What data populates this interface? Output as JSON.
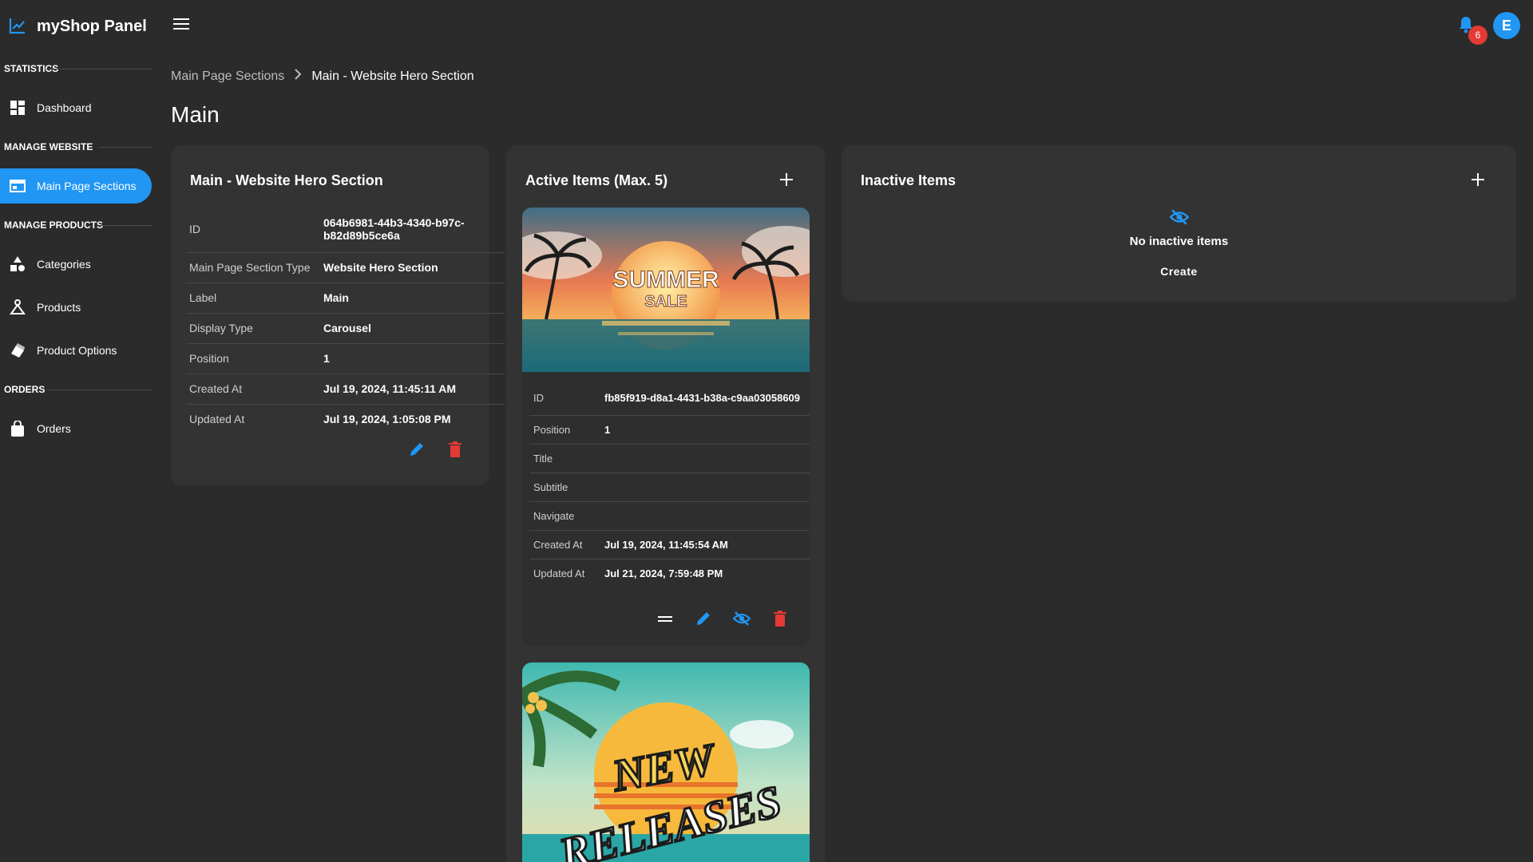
{
  "app": {
    "brand": "myShop Panel",
    "brand_icon": "trending-up-icon",
    "notifications_count": "6",
    "avatar_initial": "E",
    "accent_color": "#2196f3",
    "danger_color": "#e53935"
  },
  "sidebar": {
    "sections": [
      {
        "heading": "STATISTICS",
        "items": [
          {
            "label": "Dashboard",
            "icon": "dashboard-icon"
          }
        ]
      },
      {
        "heading": "MANAGE WEBSITE",
        "items": [
          {
            "label": "Main Page Sections",
            "icon": "web-sections-icon",
            "active": true
          }
        ]
      },
      {
        "heading": "MANAGE PRODUCTS",
        "items": [
          {
            "label": "Categories",
            "icon": "categories-icon"
          },
          {
            "label": "Products",
            "icon": "products-icon"
          },
          {
            "label": "Product Options",
            "icon": "product-options-icon"
          }
        ]
      },
      {
        "heading": "ORDERS",
        "items": [
          {
            "label": "Orders",
            "icon": "shopping-bag-icon"
          }
        ]
      }
    ]
  },
  "breadcrumb": {
    "parent": "Main Page Sections",
    "current": "Main - Website Hero Section"
  },
  "page": {
    "title": "Main"
  },
  "hero_section": {
    "title": "Main - Website Hero Section",
    "rows": [
      {
        "key": "ID",
        "value": "064b6981-44b3-4340-b97c-b82d89b5ce6a"
      },
      {
        "key": "Main Page Section Type",
        "value": "Website Hero Section"
      },
      {
        "key": "Label",
        "value": "Main"
      },
      {
        "key": "Display Type",
        "value": "Carousel"
      },
      {
        "key": "Position",
        "value": "1"
      },
      {
        "key": "Created At",
        "value": "Jul 19, 2024, 11:45:11 AM"
      },
      {
        "key": "Updated At",
        "value": "Jul 19, 2024, 1:05:08 PM"
      }
    ]
  },
  "active_items": {
    "title": "Active Items (Max. 5)",
    "items": [
      {
        "image_text_1": "SUMMER",
        "image_text_2": "SALE",
        "rows": [
          {
            "key": "ID",
            "value": "fb85f919-d8a1-4431-b38a-c9aa03058609"
          },
          {
            "key": "Position",
            "value": "1"
          },
          {
            "key": "Title",
            "value": ""
          },
          {
            "key": "Subtitle",
            "value": ""
          },
          {
            "key": "Navigate",
            "value": ""
          },
          {
            "key": "Created At",
            "value": "Jul 19, 2024, 11:45:54 AM"
          },
          {
            "key": "Updated At",
            "value": "Jul 21, 2024, 7:59:48 PM"
          }
        ]
      },
      {
        "image_text_1": "NEW",
        "image_text_2": "RELEASES"
      }
    ]
  },
  "inactive_items": {
    "title": "Inactive Items",
    "empty_text": "No inactive items",
    "create_label": "Create"
  }
}
